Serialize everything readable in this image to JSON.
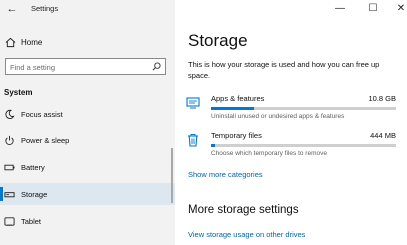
{
  "window": {
    "title": "Settings",
    "back_glyph": "←",
    "minimize_glyph": "—",
    "maximize_glyph": "☐",
    "close_glyph": "✕"
  },
  "sidebar": {
    "home": {
      "label": "Home",
      "icon": "home-icon"
    },
    "search": {
      "placeholder": "Find a setting",
      "icon": "search-icon"
    },
    "section_title": "System",
    "items": [
      {
        "label": "Focus assist",
        "icon": "focus-assist-icon"
      },
      {
        "label": "Power & sleep",
        "icon": "power-icon"
      },
      {
        "label": "Battery",
        "icon": "battery-icon"
      },
      {
        "label": "Storage",
        "icon": "storage-icon",
        "selected": true
      },
      {
        "label": "Tablet",
        "icon": "tablet-icon"
      }
    ]
  },
  "main": {
    "title": "Storage",
    "description": "This is how your storage is used and how you can free up space.",
    "categories": [
      {
        "name": "Apps & features",
        "size": "10.8 GB",
        "sub": "Uninstall unused or undesired apps & features",
        "icon": "apps-icon",
        "fill_fraction": 0.23
      },
      {
        "name": "Temporary files",
        "size": "444 MB",
        "sub": "Choose which temporary files to remove",
        "icon": "trash-icon",
        "fill_fraction": 0.02
      }
    ],
    "show_more": "Show more categories",
    "more_title": "More storage settings",
    "more_link": "View storage usage on other drives"
  },
  "colors": {
    "accent": "#0078d7",
    "link": "#0063b1",
    "sidebar_bg": "#f2f2f2",
    "bar_track": "#cfcfcf"
  }
}
